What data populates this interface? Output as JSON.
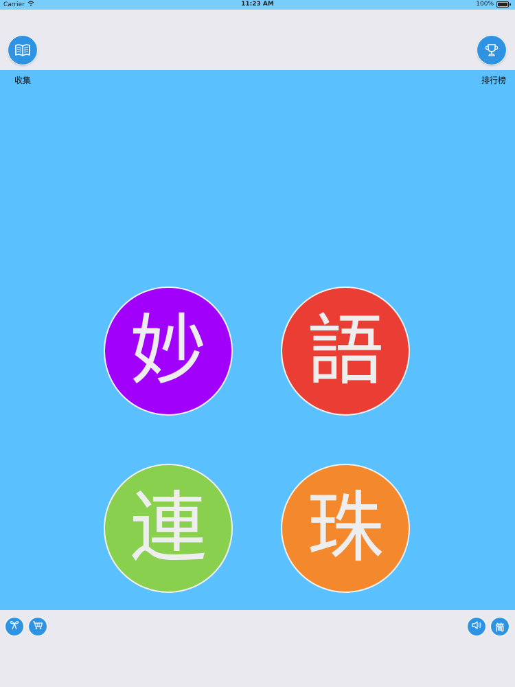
{
  "status_bar": {
    "carrier": "Carrier",
    "time": "11:23 AM",
    "battery": "100%"
  },
  "header": {
    "collect_label": "收集",
    "rank_label": "排行榜",
    "collect_icon": "book-icon",
    "rank_icon": "trophy-icon"
  },
  "tiles": [
    {
      "char": "妙",
      "color": "#a100fb"
    },
    {
      "char": "語",
      "color": "#ea3e34"
    },
    {
      "char": "連",
      "color": "#88d04d"
    },
    {
      "char": "珠",
      "color": "#f3892c"
    }
  ],
  "footer": {
    "gift_icon": "gift-icon",
    "cart_icon": "cart-icon",
    "sound_icon": "speaker-icon",
    "lang_label": "简"
  },
  "colors": {
    "accent": "#2f93e4",
    "main_bg": "#5ac0fe",
    "bar_bg": "#e9e9ef"
  }
}
